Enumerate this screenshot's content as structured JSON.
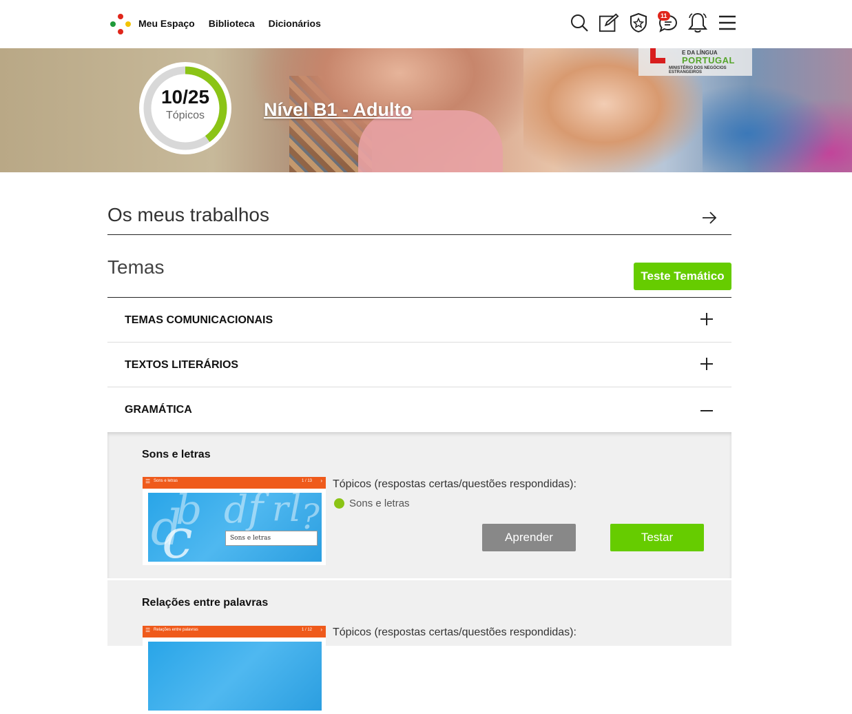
{
  "header": {
    "nav": [
      "Meu Espaço",
      "Biblioteca",
      "Dicionários"
    ],
    "icons": [
      "search-icon",
      "edit-icon",
      "badge-icon",
      "chat-icon",
      "bell-icon",
      "menu-icon"
    ],
    "chat_badge": "11"
  },
  "hero": {
    "progress_value": "10/25",
    "progress_label": "Tópicos",
    "progress_fraction": 0.4,
    "level_title": "Nível B1 - Adulto",
    "seal_line1": "E DA LÍNGUA",
    "seal_line2": "PORTUGAL",
    "seal_line3": "MINISTÉRIO DOS NEGÓCIOS ESTRANGEIROS"
  },
  "works": {
    "title": "Os meus trabalhos"
  },
  "temas": {
    "title": "Temas",
    "test_button": "Teste Temático",
    "sections": [
      {
        "label": "TEMAS COMUNICACIONAIS",
        "expanded": false
      },
      {
        "label": "TEXTOS LITERÁRIOS",
        "expanded": false
      },
      {
        "label": "GRAMÁTICA",
        "expanded": true
      }
    ]
  },
  "gramatica": {
    "items": [
      {
        "title": "Sons e letras",
        "thumb_bar_title": "Sons e letras",
        "thumb_bar_page": "1 / 13",
        "thumb_card": "Sons e letras",
        "topics_label": "Tópicos (respostas certas/questões respondidas):",
        "topic": "Sons e letras",
        "learn_button": "Aprender",
        "test_button": "Testar"
      },
      {
        "title": "Relações entre palavras",
        "thumb_bar_title": "Relações entre palavras",
        "thumb_bar_page": "1 / 12",
        "topics_label": "Tópicos (respostas certas/questões respondidas):"
      }
    ]
  },
  "colors": {
    "accent_green": "#66cc00",
    "progress_green": "#8bc416",
    "thumb_orange": "#ef5a1b"
  }
}
